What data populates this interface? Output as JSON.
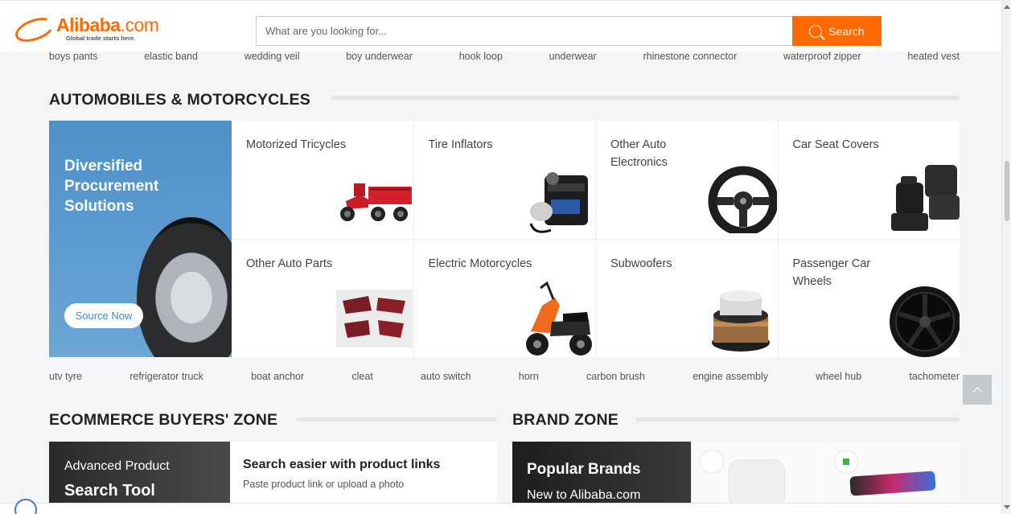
{
  "header": {
    "logo_text": "Alibaba",
    "logo_suffix": ".com",
    "logo_tagline": "Global trade starts here.",
    "search_placeholder": "What are you looking for...",
    "search_button": "Search"
  },
  "top_keywords": [
    "boys pants",
    "elastic band",
    "wedding veil",
    "boy underwear",
    "hook loop",
    "underwear",
    "rhinestone connector",
    "waterproof zipper",
    "heated vest"
  ],
  "automobiles": {
    "title": "AUTOMOBILES & MOTORCYCLES",
    "promo": {
      "title": "Diversified Procurement Solutions",
      "button": "Source Now"
    },
    "categories": [
      {
        "label": "Motorized Tricycles",
        "image": "motorized-tricycle-image"
      },
      {
        "label": "Tire Inflators",
        "image": "tire-inflator-image"
      },
      {
        "label": "Other Auto Electronics",
        "image": "steering-wheel-image"
      },
      {
        "label": "Car Seat Covers",
        "image": "car-seat-covers-image"
      },
      {
        "label": "Other Auto Parts",
        "image": "tail-lights-image"
      },
      {
        "label": "Electric Motorcycles",
        "image": "electric-motorcycle-image"
      },
      {
        "label": "Subwoofers",
        "image": "subwoofer-image"
      },
      {
        "label": "Passenger Car Wheels",
        "image": "car-wheel-image"
      }
    ],
    "keywords": [
      "utv tyre",
      "refrigerator truck",
      "boat anchor",
      "cleat",
      "auto switch",
      "horn",
      "carbon brush",
      "engine assembly",
      "wheel hub",
      "tachometer"
    ]
  },
  "ecommerce": {
    "title": "ECOMMERCE BUYERS' ZONE",
    "banner_line1": "Advanced Product",
    "banner_line2": "Search Tool",
    "heading": "Search easier with product links",
    "subtext": "Paste product link or upload a photo"
  },
  "brand_zone": {
    "title": "BRAND ZONE",
    "banner_line1": "Popular Brands",
    "banner_line2": "New to Alibaba.com"
  },
  "colors": {
    "accent": "#ff6a00",
    "promo_blue": "#5a9ad0",
    "background": "#f4f5f7"
  }
}
